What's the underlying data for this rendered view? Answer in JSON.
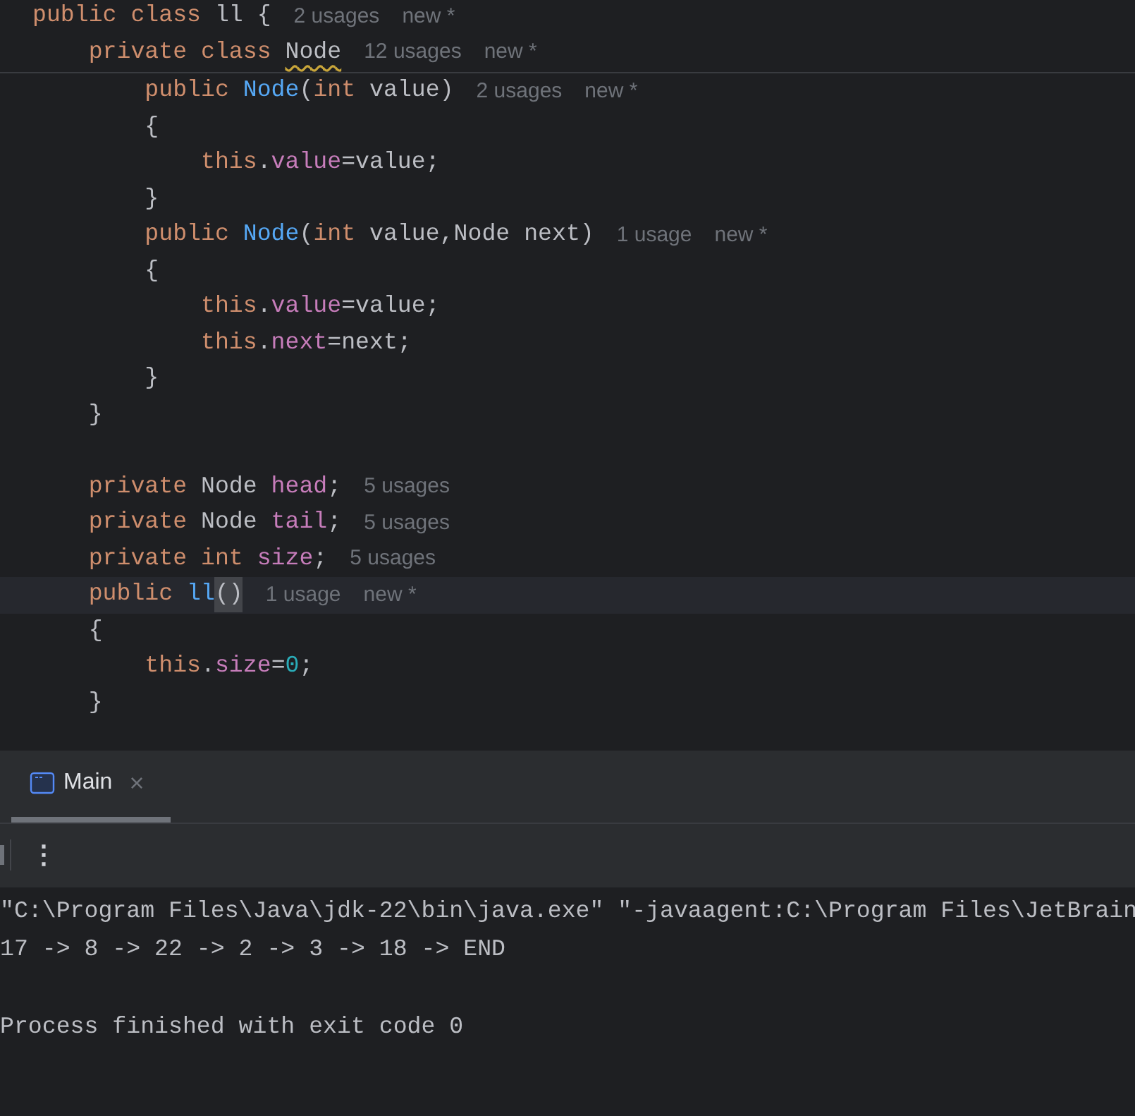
{
  "editor": {
    "sticky_lines": [
      {
        "tokens": [
          {
            "kind": "keyword",
            "text": "public class "
          },
          {
            "kind": "type",
            "text": "ll {"
          }
        ],
        "hints": [
          "2 usages",
          "new *"
        ]
      },
      {
        "tokens": [
          {
            "kind": "keyword",
            "text": "    private class "
          },
          {
            "kind": "type",
            "text": "Node",
            "warning": true
          }
        ],
        "hints": [
          "12 usages",
          "new *"
        ]
      }
    ],
    "lines": [
      {
        "tokens": [
          {
            "kind": "keyword",
            "text": "        public "
          },
          {
            "kind": "method",
            "text": "Node"
          },
          {
            "kind": "plain",
            "text": "("
          },
          {
            "kind": "keyword",
            "text": "int "
          },
          {
            "kind": "plain",
            "text": "value)"
          }
        ],
        "hints": [
          "2 usages",
          "new *"
        ]
      },
      {
        "tokens": [
          {
            "kind": "plain",
            "text": "        {"
          }
        ]
      },
      {
        "tokens": [
          {
            "kind": "keyword",
            "text": "            this"
          },
          {
            "kind": "plain",
            "text": "."
          },
          {
            "kind": "field",
            "text": "value"
          },
          {
            "kind": "plain",
            "text": "=value;"
          }
        ]
      },
      {
        "tokens": [
          {
            "kind": "plain",
            "text": "        }"
          }
        ]
      },
      {
        "tokens": [
          {
            "kind": "keyword",
            "text": "        public "
          },
          {
            "kind": "method",
            "text": "Node"
          },
          {
            "kind": "plain",
            "text": "("
          },
          {
            "kind": "keyword",
            "text": "int "
          },
          {
            "kind": "plain",
            "text": "value,Node next)"
          }
        ],
        "hints": [
          "1 usage",
          "new *"
        ]
      },
      {
        "tokens": [
          {
            "kind": "plain",
            "text": "        {"
          }
        ]
      },
      {
        "tokens": [
          {
            "kind": "keyword",
            "text": "            this"
          },
          {
            "kind": "plain",
            "text": "."
          },
          {
            "kind": "field",
            "text": "value"
          },
          {
            "kind": "plain",
            "text": "=value;"
          }
        ]
      },
      {
        "tokens": [
          {
            "kind": "keyword",
            "text": "            this"
          },
          {
            "kind": "plain",
            "text": "."
          },
          {
            "kind": "field",
            "text": "next"
          },
          {
            "kind": "plain",
            "text": "=next;"
          }
        ]
      },
      {
        "tokens": [
          {
            "kind": "plain",
            "text": "        }"
          }
        ]
      },
      {
        "tokens": [
          {
            "kind": "plain",
            "text": "    }"
          }
        ]
      },
      {
        "blank_before": true,
        "tokens": [
          {
            "kind": "keyword",
            "text": "    private "
          },
          {
            "kind": "plain",
            "text": "Node "
          },
          {
            "kind": "field",
            "text": "head"
          },
          {
            "kind": "plain",
            "text": ";"
          }
        ],
        "hints": [
          "5 usages"
        ]
      },
      {
        "tokens": [
          {
            "kind": "keyword",
            "text": "    private "
          },
          {
            "kind": "plain",
            "text": "Node "
          },
          {
            "kind": "field",
            "text": "tail"
          },
          {
            "kind": "plain",
            "text": ";"
          }
        ],
        "hints": [
          "5 usages"
        ]
      },
      {
        "tokens": [
          {
            "kind": "keyword",
            "text": "    private int "
          },
          {
            "kind": "field",
            "text": "size"
          },
          {
            "kind": "plain",
            "text": ";"
          }
        ],
        "hints": [
          "5 usages"
        ]
      },
      {
        "current": true,
        "tokens": [
          {
            "kind": "keyword",
            "text": "    public "
          },
          {
            "kind": "method",
            "text": "ll"
          },
          {
            "kind": "plain",
            "text": "()",
            "matched": true
          }
        ],
        "hints": [
          "1 usage",
          "new *"
        ]
      },
      {
        "tokens": [
          {
            "kind": "plain",
            "text": "    {"
          }
        ]
      },
      {
        "tokens": [
          {
            "kind": "keyword",
            "text": "        this"
          },
          {
            "kind": "plain",
            "text": "."
          },
          {
            "kind": "field",
            "text": "size"
          },
          {
            "kind": "plain",
            "text": "="
          },
          {
            "kind": "number",
            "text": "0"
          },
          {
            "kind": "plain",
            "text": ";"
          }
        ]
      },
      {
        "tokens": [
          {
            "kind": "plain",
            "text": "    }"
          }
        ]
      }
    ]
  },
  "run_panel": {
    "tabs": [
      {
        "label": "Main",
        "selected": true,
        "close": "×"
      }
    ],
    "menu": "⋮",
    "console_lines": [
      {
        "text": "\"C:\\Program Files\\Java\\jdk-22\\bin\\java.exe\" \"-javaagent:C:\\Program Files\\JetBrain"
      },
      {
        "text": "17 -> 8 -> 22 -> 2 -> 3 -> 18 -> END"
      },
      {
        "text": "Process finished with exit code 0",
        "blank_before": true
      }
    ]
  }
}
